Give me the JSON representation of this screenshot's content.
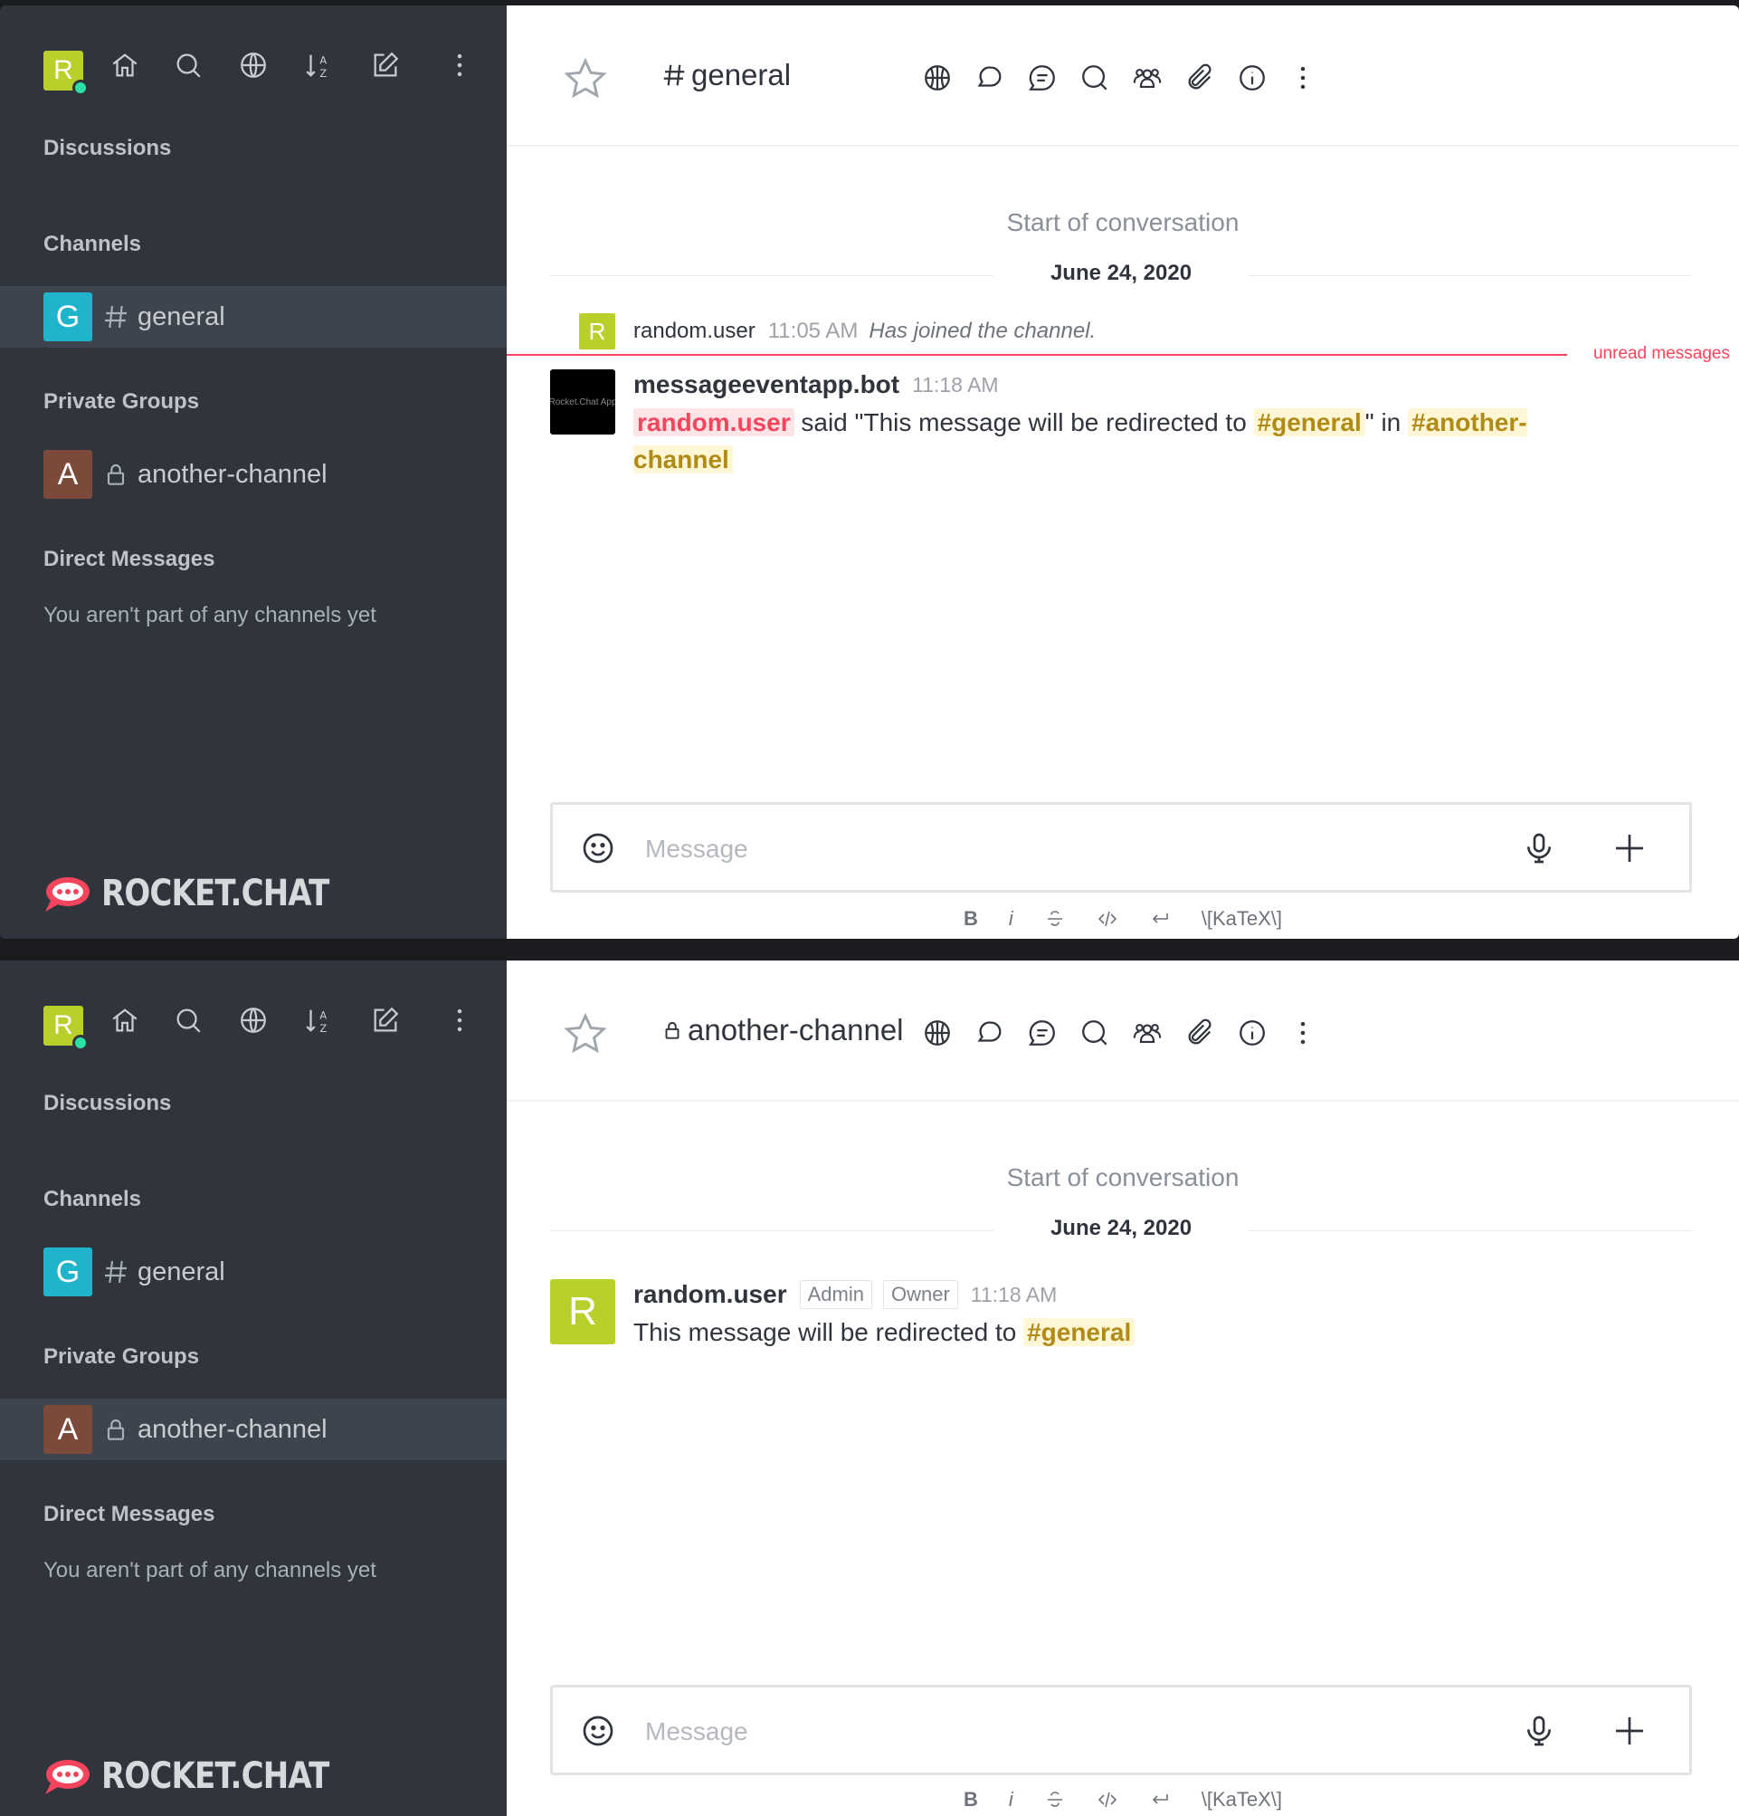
{
  "sidebar": {
    "user_initial": "R",
    "sections": {
      "discussions": "Discussions",
      "channels": "Channels",
      "private_groups": "Private Groups",
      "direct_messages": "Direct Messages"
    },
    "rooms": {
      "general": {
        "initial": "G",
        "name": "general",
        "avatar_color": "#1fb4cc"
      },
      "another": {
        "initial": "A",
        "name": "another-channel",
        "avatar_color": "#7b4a3a"
      }
    },
    "dm_empty": "You aren't part of any channels yet",
    "logo_text": "ROCKET.CHAT",
    "icons": [
      "home-icon",
      "search-icon",
      "directory-icon",
      "sort-icon",
      "create-new-icon",
      "kebab-menu-icon"
    ]
  },
  "view1": {
    "room_title": "general",
    "start_text": "Start of conversation",
    "date": "June 24, 2020",
    "system_message": {
      "avatar_initial": "R",
      "username": "random.user",
      "time": "11:05 AM",
      "text": "Has joined the channel."
    },
    "unread_label": "unread messages",
    "message": {
      "avatar_text": "Rocket.Chat App",
      "username": "messageeventapp.bot",
      "time": "11:18 AM",
      "mention": "random.user",
      "text_1": " said \"This message will be redirected to ",
      "channel_1": "#general",
      "text_2": "\" in ",
      "channel_2": "#another-channel"
    }
  },
  "view2": {
    "room_title": "another-channel",
    "start_text": "Start of conversation",
    "date": "June 24, 2020",
    "message": {
      "avatar_initial": "R",
      "username": "random.user",
      "role_1": "Admin",
      "role_2": "Owner",
      "time": "11:18 AM",
      "text": "This message will be redirected to ",
      "channel": "#general"
    }
  },
  "composer": {
    "placeholder": "Message",
    "format_bold": "B",
    "format_italic": "i",
    "katex": "\\[KaTeX\\]"
  },
  "header_icons": [
    "video-call-icon",
    "discussion-icon",
    "threads-icon",
    "search-messages-icon",
    "members-icon",
    "files-icon",
    "room-info-icon",
    "kebab-menu-icon"
  ],
  "colors": {
    "sidebar_bg": "#2f343d",
    "mention": "#f5455c",
    "channel_link": "#b08b16",
    "user_avatar": "#b8cf2c"
  }
}
